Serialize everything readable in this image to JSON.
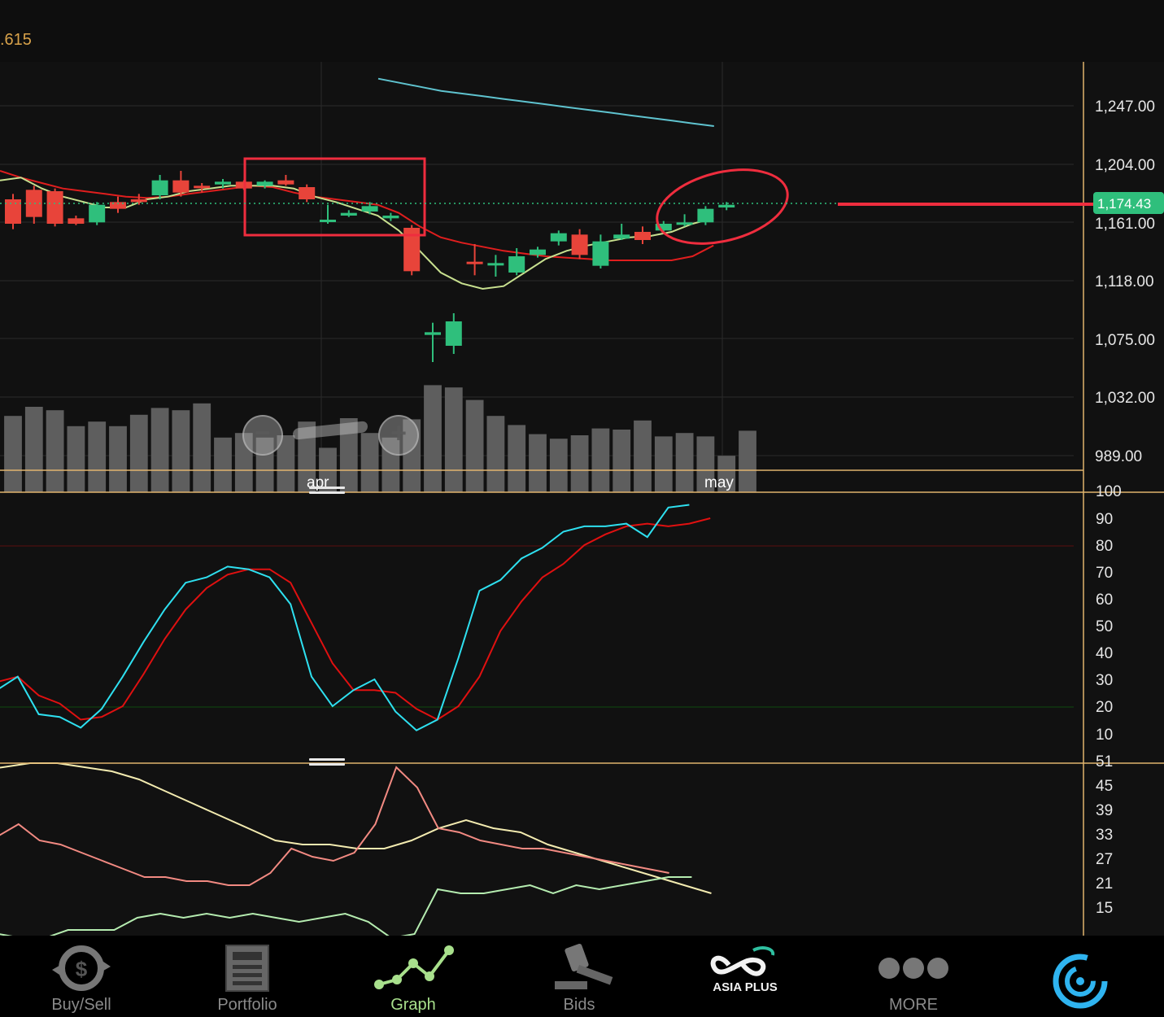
{
  "header": {
    "top_value": ".615"
  },
  "price_axis": {
    "labels": [
      "1,247.00",
      "1,204.00",
      "1,161.00",
      "1,118.00",
      "1,075.00",
      "1,032.00",
      "989.00"
    ],
    "current_price": "1,174.43",
    "badge_color": "#2fbf7c"
  },
  "stoch_axis": {
    "labels": [
      "100",
      "90",
      "80",
      "70",
      "60",
      "50",
      "40",
      "30",
      "20",
      "10"
    ]
  },
  "dmi_axis": {
    "labels": [
      "51",
      "45",
      "39",
      "33",
      "27",
      "21",
      "15"
    ]
  },
  "dates": {
    "apr": "apr",
    "may": "may"
  },
  "colors": {
    "up": "#2fbf7c",
    "down": "#e8443a",
    "ma_red": "#e01e1e",
    "ma_green": "#c8e08f",
    "ma_cyan": "#5fc3cf",
    "stoch_k": "#2ee0f0",
    "stoch_d": "#e01010",
    "dmi_yellow": "#f3ebb0",
    "dmi_pink": "#f28a82",
    "dmi_green": "#b5ecb0",
    "annotation": "#ef2d3e",
    "axis_line": "#e0b46e"
  },
  "chart_data": {
    "type": "candlestick",
    "price_ylim": [
      989,
      1247
    ],
    "candles": [
      {
        "o": 1178,
        "h": 1182,
        "l": 1156,
        "c": 1160
      },
      {
        "o": 1185,
        "h": 1188,
        "l": 1160,
        "c": 1165
      },
      {
        "o": 1184,
        "h": 1186,
        "l": 1158,
        "c": 1160
      },
      {
        "o": 1164,
        "h": 1166,
        "l": 1159,
        "c": 1160
      },
      {
        "o": 1161,
        "h": 1176,
        "l": 1159,
        "c": 1174
      },
      {
        "o": 1176,
        "h": 1180,
        "l": 1168,
        "c": 1171
      },
      {
        "o": 1178,
        "h": 1182,
        "l": 1174,
        "c": 1176
      },
      {
        "o": 1181,
        "h": 1196,
        "l": 1178,
        "c": 1192
      },
      {
        "o": 1192,
        "h": 1199,
        "l": 1180,
        "c": 1183
      },
      {
        "o": 1188,
        "h": 1190,
        "l": 1183,
        "c": 1187
      },
      {
        "o": 1189,
        "h": 1193,
        "l": 1186,
        "c": 1191
      },
      {
        "o": 1191,
        "h": 1192,
        "l": 1185,
        "c": 1186
      },
      {
        "o": 1188,
        "h": 1192,
        "l": 1186,
        "c": 1191
      },
      {
        "o": 1192,
        "h": 1196,
        "l": 1188,
        "c": 1189
      },
      {
        "o": 1187,
        "h": 1189,
        "l": 1176,
        "c": 1178
      },
      {
        "o": 1162,
        "h": 1174,
        "l": 1160,
        "c": 1163
      },
      {
        "o": 1166,
        "h": 1170,
        "l": 1165,
        "c": 1168
      },
      {
        "o": 1169,
        "h": 1176,
        "l": 1167,
        "c": 1173
      },
      {
        "o": 1164,
        "h": 1168,
        "l": 1162,
        "c": 1166
      },
      {
        "o": 1157,
        "h": 1159,
        "l": 1122,
        "c": 1125
      },
      {
        "o": 1078,
        "h": 1087,
        "l": 1058,
        "c": 1080
      },
      {
        "o": 1070,
        "h": 1094,
        "l": 1064,
        "c": 1088
      },
      {
        "o": 1132,
        "h": 1145,
        "l": 1122,
        "c": 1131
      },
      {
        "o": 1130,
        "h": 1137,
        "l": 1121,
        "c": 1131
      },
      {
        "o": 1124,
        "h": 1142,
        "l": 1122,
        "c": 1136
      },
      {
        "o": 1137,
        "h": 1143,
        "l": 1135,
        "c": 1141
      },
      {
        "o": 1147,
        "h": 1155,
        "l": 1144,
        "c": 1153
      },
      {
        "o": 1152,
        "h": 1156,
        "l": 1134,
        "c": 1137
      },
      {
        "o": 1129,
        "h": 1152,
        "l": 1127,
        "c": 1147
      },
      {
        "o": 1149,
        "h": 1160,
        "l": 1148,
        "c": 1152
      },
      {
        "o": 1154,
        "h": 1158,
        "l": 1145,
        "c": 1148
      },
      {
        "o": 1155,
        "h": 1162,
        "l": 1153,
        "c": 1160
      },
      {
        "o": 1161,
        "h": 1167,
        "l": 1158,
        "c": 1161
      },
      {
        "o": 1161,
        "h": 1173,
        "l": 1159,
        "c": 1171
      },
      {
        "o": 1172,
        "h": 1176,
        "l": 1170,
        "c": 1174
      }
    ],
    "ma_red": [
      1199,
      1194,
      1190,
      1186,
      1184,
      1182,
      1180,
      1179,
      1180,
      1182,
      1184,
      1186,
      1188,
      1187,
      1183,
      1180,
      1178,
      1176,
      1174,
      1168,
      1158,
      1150,
      1146,
      1143,
      1140,
      1138,
      1136,
      1135,
      1134,
      1133,
      1133,
      1133,
      1133,
      1136,
      1144
    ],
    "ma_green": [
      1192,
      1194,
      1186,
      1180,
      1176,
      1172,
      1172,
      1178,
      1180,
      1184,
      1186,
      1188,
      1188,
      1188,
      1186,
      1180,
      1176,
      1171,
      1166,
      1155,
      1140,
      1124,
      1116,
      1112,
      1114,
      1124,
      1134,
      1140,
      1144,
      1147,
      1150,
      1151,
      1154,
      1160,
      1164
    ],
    "ma_cyan": [
      1267,
      1264,
      1261,
      1258,
      1256,
      1254,
      1252,
      1250,
      1248,
      1246,
      1244,
      1242,
      1240,
      1238,
      1236,
      1234,
      1232
    ],
    "volume": [
      67,
      75,
      72,
      58,
      62,
      58,
      68,
      74,
      72,
      78,
      48,
      52,
      48,
      50,
      62,
      39,
      65,
      52,
      48,
      64,
      94,
      92,
      81,
      67,
      59,
      51,
      47,
      50,
      56,
      55,
      63,
      49,
      52,
      49,
      32,
      54
    ],
    "stoch_k": [
      26,
      31,
      17,
      16,
      12,
      19,
      31,
      44,
      56,
      66,
      68,
      72,
      71,
      68,
      58,
      31,
      20,
      26,
      30,
      18,
      11,
      15,
      38,
      63,
      67,
      75,
      79,
      85,
      87,
      87,
      88,
      83,
      94,
      95
    ],
    "stoch_d": [
      29,
      31,
      24,
      21,
      15,
      16,
      20,
      32,
      45,
      56,
      64,
      69,
      71,
      71,
      66,
      51,
      36,
      26,
      26,
      25,
      19,
      15,
      20,
      31,
      48,
      59,
      68,
      73,
      80,
      84,
      87,
      88,
      87,
      88,
      90
    ],
    "stoch_ylim": [
      0,
      100
    ],
    "dmi_yellow": [
      49,
      50,
      51,
      51,
      50,
      49,
      47,
      44,
      41,
      38,
      35,
      32,
      31,
      31,
      30,
      30,
      32,
      35,
      37,
      35,
      34,
      31,
      29,
      27,
      25,
      23,
      21,
      19
    ],
    "dmi_pink": [
      33,
      36,
      32,
      31,
      29,
      27,
      25,
      23,
      23,
      22,
      22,
      21,
      21,
      24,
      30,
      28,
      27,
      29,
      36,
      50,
      45,
      35,
      34,
      32,
      31,
      30,
      30,
      29,
      28,
      27,
      26,
      25,
      24
    ],
    "dmi_green": [
      9,
      9,
      8,
      8,
      10,
      10,
      10,
      13,
      14,
      13,
      14,
      13,
      14,
      13,
      12,
      13,
      14,
      12,
      8,
      9,
      20,
      19,
      19,
      20,
      21,
      19,
      21,
      20,
      21,
      22,
      23,
      23
    ],
    "dmi_ylim": [
      8,
      51
    ]
  },
  "nav": [
    {
      "label": "Buy/Sell",
      "icon": "buy-sell-icon"
    },
    {
      "label": "Portfolio",
      "icon": "portfolio-icon"
    },
    {
      "label": "Graph",
      "icon": "graph-icon"
    },
    {
      "label": "Bids",
      "icon": "gavel-icon"
    },
    {
      "label": "",
      "icon": "asia-plus-logo",
      "logo_text": "ASIA PLUS"
    },
    {
      "label": "MORE",
      "icon": "more-icon"
    },
    {
      "label": "",
      "icon": "refresh-logo-icon"
    }
  ]
}
